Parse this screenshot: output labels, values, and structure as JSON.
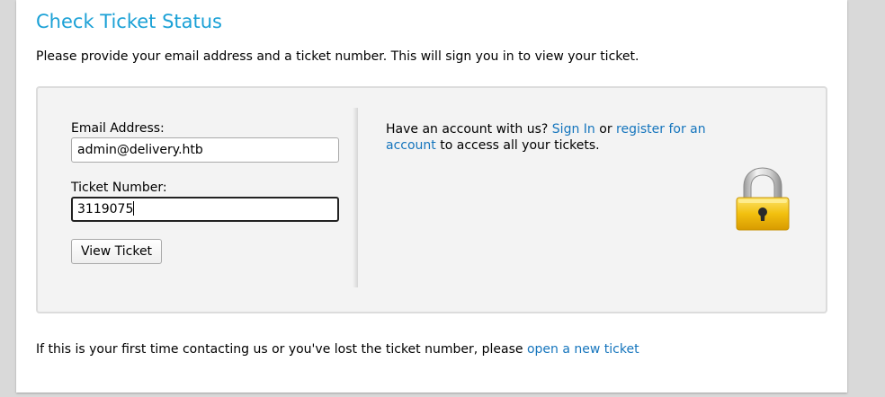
{
  "header": {
    "title": "Check Ticket Status",
    "intro": "Please provide your email address and a ticket number. This will sign you in to view your ticket."
  },
  "form": {
    "email_label": "Email Address:",
    "email_value": "admin@delivery.htb",
    "ticket_label": "Ticket Number:",
    "ticket_value": "3119075",
    "submit_label": "View Ticket"
  },
  "side": {
    "text_before": "Have an account with us? ",
    "sign_in_link": "Sign In",
    "text_or": " or ",
    "register_link": "register for an account",
    "text_after": " to access all your tickets."
  },
  "footer": {
    "text": "If this is your first time contacting us or you've lost the ticket number, please ",
    "new_ticket_link": "open a new ticket"
  },
  "colors": {
    "title": "#1ba1d6",
    "link": "#1575bd",
    "lock_body": "#f2c00f"
  },
  "icons": {
    "lock": "padlock-icon"
  }
}
